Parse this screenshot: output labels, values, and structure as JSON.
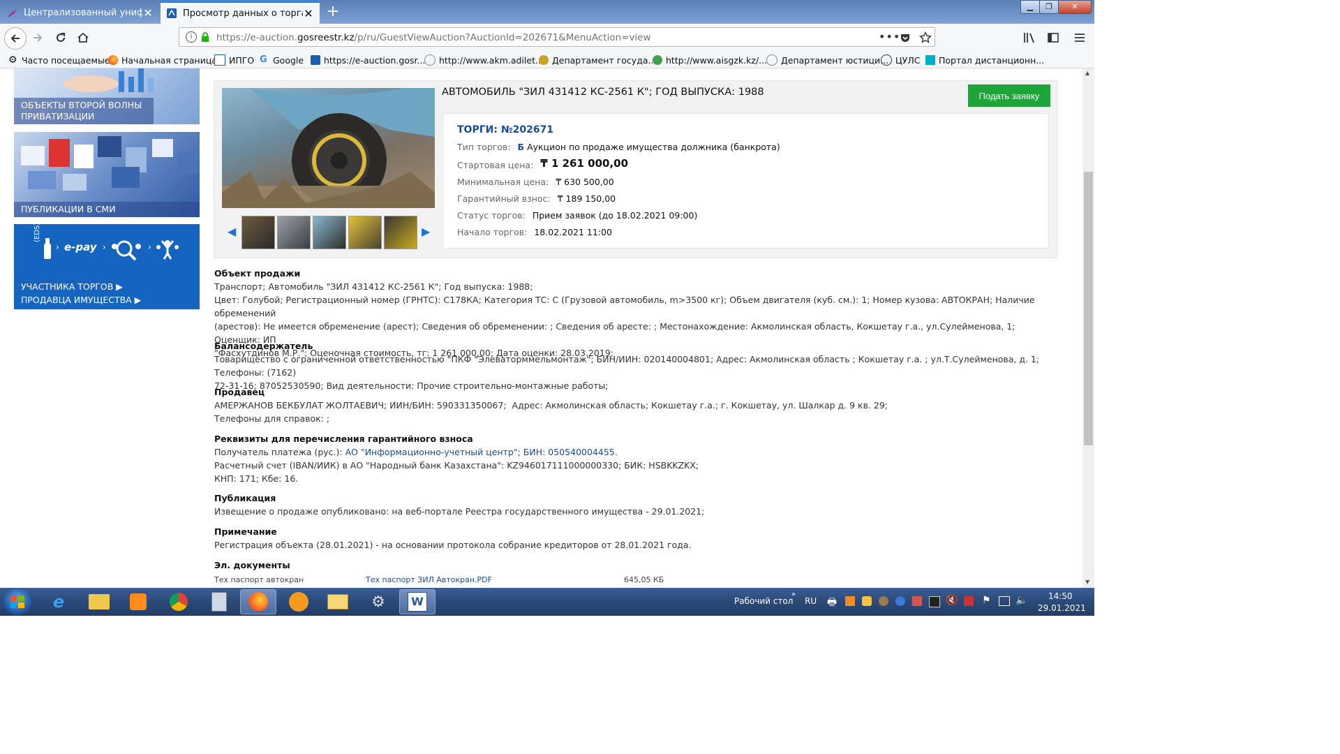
{
  "browser": {
    "tabs": [
      {
        "title": "Централизованный унифици",
        "active": false
      },
      {
        "title": "Просмотр данных о торгах",
        "active": true
      }
    ],
    "url": {
      "prefix": "https://e-auction.",
      "domain": "gosreestr.kz",
      "path": "/p/ru/GuestViewAuction?AuctionId=202671&MenuAction=view"
    },
    "bookmarks": [
      "Часто посещаемые",
      "Начальная страница",
      "ИПГО",
      "Google",
      "https://e-auction.gosr...",
      "http://www.akm.adilet...",
      "Департамент госуда...",
      "http://www.aisgzk.kz/...",
      "Департамент юстици...",
      "ЦУЛС",
      "Портал дистанционн..."
    ]
  },
  "sidebar": {
    "card1": "ОБЪЕКТЫ ВТОРОЙ ВОЛНЫ ПРИВАТИЗАЦИИ",
    "card2": "ПУБЛИКАЦИИ В СМИ",
    "epay_brand": "e-pay",
    "epay_eds": "(EDS)",
    "epay_link1": "УЧАСТНИКА ТОРГОВ ▶",
    "epay_link2": "ПРОДАВЦА ИМУЩЕСТВА ▶"
  },
  "lot": {
    "title": "АВТОМОБИЛЬ \"ЗИЛ 431412 КС-2561 К\"; ГОД ВЫПУСКА: 1988",
    "apply_button": "Подать заявку",
    "auction_no": "ТОРГИ: №202671",
    "type_label": "Тип торгов:",
    "type_badge": "Б",
    "type_value": "Аукцион по продаже имущества должника (банкрота)",
    "start_price_label": "Стартовая цена:",
    "start_price": "₸ 1 261 000,00",
    "min_price_label": "Минимальная цена:",
    "min_price": "₸ 630 500,00",
    "deposit_label": "Гарантийный взнос:",
    "deposit": "₸ 189 150,00",
    "status_label": "Статус торгов:",
    "status": "Прием заявок (до 18.02.2021 09:00)",
    "start_label": "Начало торгов:",
    "start_date": "18.02.2021 11:00"
  },
  "details": {
    "object_hd": "Объект продажи",
    "object_l1": "Транспорт; Автомобиль \"ЗИЛ 431412 КС-2561 К\"; Год выпуска: 1988;",
    "object_l2": "Цвет: Голубой; Регистрационный номер (ГРНТС): С178КА; Категория ТС: С (Грузовой автомобиль, m>3500 кг); Объем двигателя (куб. см.): 1; Номер кузова: АВТОКРАН; Наличие обременений",
    "object_l3": "(арестов): Не имеется обременение (арест); Сведения об обременении: ; Сведения об аресте: ; Местонахождение: Акмолинская область, Кокшетау г.а., ул.Сулейменова, 1; Оценщик: ИП",
    "object_l4": "\"Фасхутдинов М.Р.\"; Оценочная стоимость, тг: 1 261 000,00; Дата оценки: 28.03.2019;",
    "holder_hd": "Балансодержатель",
    "holder_l1": "Товарищество с ограниченной ответственностью \"ПКФ \"Элеваторммельмонтаж\"; БИН/ИИН: 020140004801; Адрес: Акмолинская область ; Кокшетау г.а. ; ул.Т.Сулейменова, д. 1; Телефоны: (7162)",
    "holder_l2": "72-31-16; 87052530590; Вид деятельности: Прочие строительно-монтажные работы;",
    "seller_hd": "Продавец",
    "seller_l1": "АМЕРЖАНОВ БЕКБУЛАТ ЖОЛТАЕВИЧ; ИИН/БИН: 590331350067;  Адрес: Акмолинская область; Кокшетау г.а.; г. Кокшетау, ул. Шалкар д. 9 кв. 29;",
    "seller_l2": "Телефоны для справок: ;",
    "req_hd": "Реквизиты для перечисления гарантийного взноса",
    "req_l1_label": "Получатель платежа (рус.): ",
    "req_l1_link": "АО \"Информационно-учетный центр\"; БИН: 050540004455.",
    "req_l2": "Расчетный счет (IBAN/ИИК) в АО \"Народный банк Казахстана\": KZ946017111000000330; БИК: HSBKKZKX;",
    "req_l3": "КНП: 171; Кбе: 16.",
    "pub_hd": "Публикация",
    "pub_l1": "Извещение о продаже опубликовано: на веб-портале Реестра государственного имущества - 29.01.2021;",
    "note_hd": "Примечание",
    "note_l1": "Регистрация объекта (28.01.2021) - на основании протокола собрание кредиторов от 28.01.2021 года.",
    "docs_hd": "Эл. документы",
    "doc_name": "Тех паспорт автокран",
    "doc_file": "Тех паспорт ЗИЛ Автокран.PDF",
    "doc_size": "645,05 КБ"
  },
  "taskbar": {
    "desktop_label": "Рабочий стол",
    "lang": "RU",
    "time": "14:50",
    "date": "29.01.2021"
  },
  "colors": {
    "accent_blue": "#1a4a9a",
    "apply_green": "#1da53a",
    "taskbar": "#2c4b7a"
  }
}
